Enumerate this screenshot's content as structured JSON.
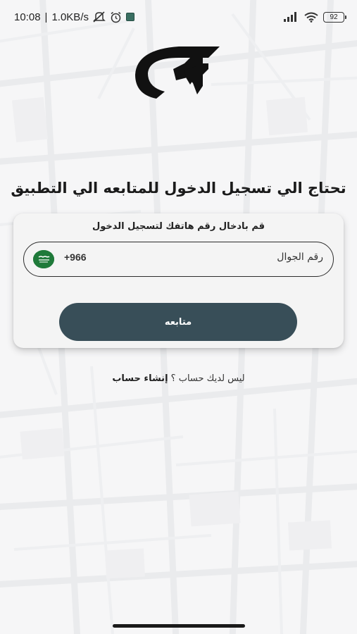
{
  "status_bar": {
    "time": "10:08",
    "separator": "|",
    "network_speed": "1.0KB/s",
    "battery_level": "92",
    "icons": [
      "mute-icon",
      "alarm-icon",
      "app-notification-icon",
      "signal-icon",
      "wifi-icon",
      "battery-icon"
    ]
  },
  "heading": "تحتاج الي تسجيل الدخول للمتابعه الي التطبيق",
  "login_card": {
    "subtitle": "قم بادخال رقم هاتفك لتسجيل الدخول",
    "phone_field": {
      "label": "رقم الجوال",
      "dial_code": "+966",
      "value": "",
      "placeholder": "",
      "country_flag": "saudi-arabia-flag-icon"
    },
    "continue_button": "متابعه"
  },
  "signup": {
    "question": "ليس لديك حساب ؟",
    "link_label": "إنشاء حساب"
  },
  "colors": {
    "button_bg": "#384e58",
    "card_bg": "#f4f4f4",
    "field_border": "#2c2c2c",
    "flag_green": "#1f7a3a",
    "map_bg": "#f6f6f7"
  }
}
